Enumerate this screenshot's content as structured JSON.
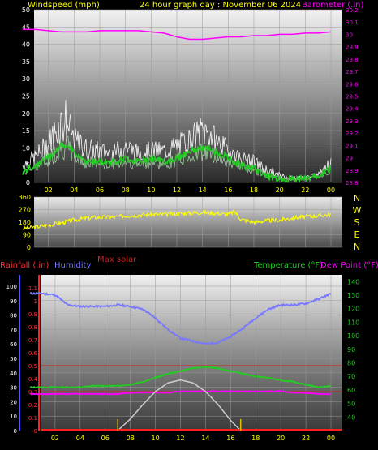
{
  "header": {
    "windspeed_label": "Windspeed (mph)",
    "date_label": "24 hour graph day : November 06 2024",
    "barometer_label": "Barometer (.in)"
  },
  "direction_panel": {
    "compass_letters": [
      "N",
      "W",
      "S",
      "E",
      "N"
    ]
  },
  "lower_header": {
    "rainfall_label": "Rainfall (.in)",
    "humidity_label": "Humidity",
    "temperature_label": "Temperature (°F)",
    "dewpoint_label": "Dew Point (°F)",
    "max_solar_label": "Max solar"
  },
  "colors": {
    "wind": "#ffffff",
    "wind_avg": "#22cc22",
    "barometer": "#ff00ff",
    "direction": "#ffff00",
    "humidity": "#7777ff",
    "temperature": "#22cc22",
    "dewpoint": "#ff00ff",
    "rain": "#ff2020",
    "solar": "#cccccc",
    "grid_red": "#cc2020"
  },
  "chart_data": [
    {
      "type": "line",
      "title": "24 hour graph day : November 06 2024",
      "xlabel": "",
      "x_ticks": [
        "02",
        "04",
        "06",
        "08",
        "10",
        "12",
        "14",
        "16",
        "18",
        "20",
        "22",
        "00"
      ],
      "x_range": [
        0,
        24
      ],
      "left_axis": {
        "label": "Windspeed (mph)",
        "ylim": [
          0,
          50
        ],
        "ticks": [
          0,
          5,
          10,
          15,
          20,
          25,
          30,
          35,
          40,
          45,
          50
        ]
      },
      "right_axis": {
        "label": "Barometer (.in)",
        "ylim": [
          28.8,
          30.2
        ],
        "ticks": [
          "28.8",
          "28.9",
          "29",
          "29.1",
          "29.2",
          "29.3",
          "29.4",
          "29.5",
          "29.6",
          "29.7",
          "29.8",
          "29.9",
          "30",
          "30.1",
          "30.2"
        ]
      },
      "series": [
        {
          "name": "Barometer (.in)",
          "axis": "right",
          "x": [
            0,
            1,
            2,
            3,
            4,
            5,
            6,
            7,
            8,
            9,
            10,
            11,
            12,
            13,
            14,
            15,
            16,
            17,
            18,
            19,
            20,
            21,
            22,
            23,
            24
          ],
          "values": [
            30.04,
            30.04,
            30.03,
            30.02,
            30.02,
            30.02,
            30.03,
            30.03,
            30.03,
            30.03,
            30.02,
            30.01,
            29.98,
            29.96,
            29.96,
            29.97,
            29.98,
            29.98,
            29.99,
            29.99,
            30.0,
            30.0,
            30.01,
            30.01,
            30.02
          ]
        },
        {
          "axis": "left",
          "style": "gust",
          "x": [
            0,
            1,
            2,
            2.8,
            3.3,
            4,
            5,
            6,
            7,
            8,
            9,
            10,
            11,
            12,
            13,
            13.5,
            14,
            14.5,
            15,
            16,
            17,
            18,
            19,
            20,
            21,
            22,
            23,
            23.5,
            24
          ],
          "values": [
            7,
            10,
            15,
            22,
            26,
            16,
            13,
            12,
            11,
            14,
            11,
            12,
            12,
            14,
            16,
            18,
            20,
            19,
            16,
            12,
            9,
            8,
            5,
            3,
            2,
            2,
            3,
            6,
            7
          ]
        },
        {
          "axis": "left",
          "style": "average",
          "x": [
            0,
            1,
            2,
            3,
            4,
            5,
            6,
            7,
            8,
            9,
            10,
            11,
            12,
            13,
            14,
            15,
            16,
            17,
            18,
            19,
            20,
            21,
            22,
            23,
            24
          ],
          "values": [
            3,
            5,
            7,
            11,
            9,
            6,
            6,
            6,
            7,
            6,
            7,
            6,
            7,
            9,
            10,
            9,
            7,
            5,
            4,
            2,
            1,
            1,
            1,
            2,
            4
          ]
        }
      ]
    },
    {
      "type": "line",
      "title": "",
      "left_axis": {
        "ylim": [
          0,
          360
        ],
        "ticks": [
          0,
          90,
          180,
          270,
          360
        ]
      },
      "series": [
        {
          "axis": "left",
          "x": [
            0,
            1,
            2,
            3,
            4,
            5,
            6,
            7,
            8,
            9,
            10,
            11,
            12,
            13,
            14,
            15,
            16,
            16.5,
            17,
            18,
            19,
            20,
            21,
            22,
            23,
            24
          ],
          "values": [
            135,
            145,
            160,
            175,
            195,
            210,
            215,
            215,
            225,
            230,
            235,
            235,
            240,
            245,
            250,
            245,
            235,
            255,
            200,
            180,
            190,
            195,
            210,
            220,
            225,
            235
          ]
        }
      ]
    },
    {
      "type": "line",
      "title": "",
      "left_axis_humidity": {
        "label": "Humidity",
        "ylim": [
          0,
          100
        ],
        "ticks": [
          0,
          10,
          20,
          30,
          40,
          50,
          60,
          70,
          80,
          90,
          100
        ]
      },
      "left_axis_rain": {
        "label": "Rainfall (.in)",
        "ylim": [
          0,
          1.2
        ],
        "ticks": [
          "0",
          "0.1",
          "0.2",
          "0.3",
          "0.4",
          "0.5",
          "0.6",
          "0.7",
          "0.8",
          "0.9",
          "1",
          "1.1"
        ]
      },
      "right_axis": {
        "label": "Temperature (°F)",
        "ylim": [
          30,
          145
        ],
        "ticks": [
          40,
          50,
          60,
          70,
          80,
          90,
          100,
          110,
          120,
          130,
          140
        ]
      },
      "series": [
        {
          "name": "Humidity",
          "axis": "humidity",
          "x": [
            0,
            1,
            2,
            3,
            4,
            5,
            6,
            7,
            8,
            9,
            10,
            11,
            12,
            13,
            14,
            15,
            16,
            17,
            18,
            19,
            20,
            21,
            22,
            23,
            24
          ],
          "values": [
            95,
            95,
            94,
            87,
            86,
            86,
            86,
            87,
            86,
            84,
            78,
            70,
            64,
            62,
            60,
            61,
            65,
            71,
            78,
            84,
            87,
            87,
            88,
            91,
            95
          ]
        },
        {
          "name": "Temperature (°F)",
          "axis": "right",
          "x": [
            0,
            1,
            2,
            3,
            4,
            5,
            6,
            7,
            8,
            9,
            10,
            11,
            12,
            13,
            14,
            15,
            16,
            17,
            18,
            19,
            20,
            21,
            22,
            23,
            24
          ],
          "values": [
            62,
            62,
            62,
            62,
            62,
            63,
            63,
            63,
            64,
            66,
            69,
            72,
            74,
            76,
            77,
            76,
            74,
            72,
            70,
            69,
            67,
            66,
            64,
            62,
            63
          ]
        },
        {
          "name": "Dew Point (°F)",
          "axis": "right",
          "x": [
            0,
            1,
            2,
            3,
            4,
            5,
            6,
            7,
            8,
            9,
            10,
            11,
            12,
            13,
            14,
            15,
            16,
            17,
            18,
            19,
            20,
            21,
            22,
            23,
            24
          ],
          "values": [
            57,
            57,
            57,
            57,
            57,
            57,
            57,
            57,
            58,
            58,
            58,
            58,
            59,
            59,
            59,
            59,
            59,
            59,
            59,
            59,
            59,
            58,
            58,
            57,
            57
          ]
        },
        {
          "name": "Max solar",
          "axis": "humidity",
          "x": [
            7,
            8,
            9,
            10,
            11,
            12,
            13,
            14,
            15,
            16,
            16.8
          ],
          "values": [
            0,
            8,
            18,
            27,
            33,
            35,
            33,
            27,
            18,
            7,
            0
          ]
        },
        {
          "name": "Rainfall (.in)",
          "axis": "rain",
          "x": [
            0,
            24
          ],
          "values": [
            0,
            0
          ]
        }
      ],
      "markers": {
        "sunrise": 7,
        "sunset": 16.8
      },
      "reference_lines_rain": [
        0.3,
        0.5
      ]
    }
  ]
}
